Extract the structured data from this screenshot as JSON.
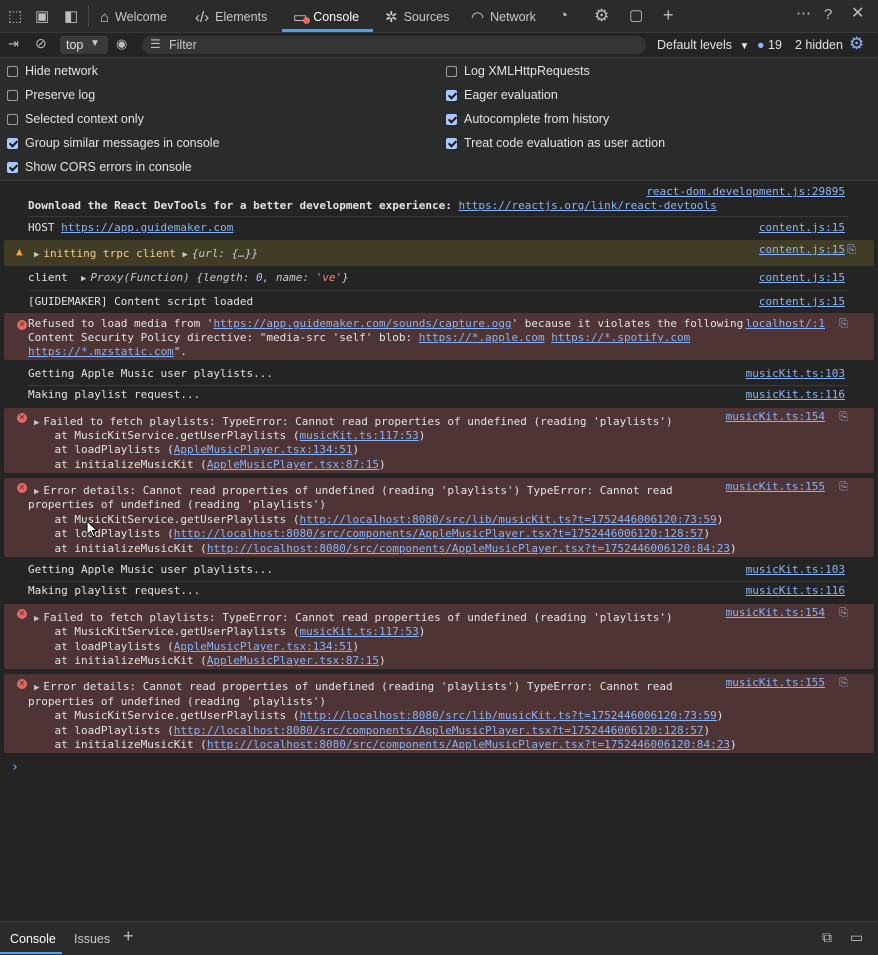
{
  "tabs": [
    {
      "label": "Welcome",
      "icon": "home-icon"
    },
    {
      "label": "Elements",
      "icon": "code-icon"
    },
    {
      "label": "Console",
      "icon": "console-icon"
    },
    {
      "label": "Sources",
      "icon": "bug-icon"
    },
    {
      "label": "Network",
      "icon": "wifi-icon"
    }
  ],
  "toolbar": {
    "context": "top",
    "filter_placeholder": "Filter",
    "levels": "Default levels",
    "issues_count": "19",
    "hidden": "2 hidden"
  },
  "settings": {
    "left": [
      {
        "label": "Hide network",
        "checked": false
      },
      {
        "label": "Preserve log",
        "checked": false
      },
      {
        "label": "Selected context only",
        "checked": false
      },
      {
        "label": "Group similar messages in console",
        "checked": true
      },
      {
        "label": "Show CORS errors in console",
        "checked": true
      }
    ],
    "right": [
      {
        "label": "Log XMLHttpRequests",
        "checked": false
      },
      {
        "label": "Eager evaluation",
        "checked": true
      },
      {
        "label": "Autocomplete from history",
        "checked": true
      },
      {
        "label": "Treat code evaluation as user action",
        "checked": true
      }
    ]
  },
  "console": {
    "m1_src": "react-dom.development.js:29895",
    "m1_text": "Download the React DevTools for a better development experience: ",
    "m1_link": "https://reactjs.org/link/react-devtools",
    "m2_text": "HOST ",
    "m2_link": "https://app.guidemaker.com",
    "m2_src": "content.js:15",
    "m3_text": "initting trpc client",
    "m3_obj": "{url: {…}}",
    "m3_src": "content.js:15",
    "m4_text": "client",
    "m4_obj_a": "Proxy(Function) {length: ",
    "m4_obj_num": "0",
    "m4_obj_b": ", name: ",
    "m4_obj_str": "'ve'",
    "m4_obj_c": "}",
    "m4_src": "content.js:15",
    "m5_text": "[GUIDEMAKER] Content script loaded",
    "m5_src": "content.js:15",
    "m6_a": "Refused to load media from '",
    "m6_link1": "https://app.guidemaker.com/sounds/capture.ogg",
    "m6_b": "' because it violates the following",
    "m6_c": "Content Security Policy directive: \"media-src 'self' blob: ",
    "m6_link2": "https://*.apple.com",
    "m6_link3": "https://*.spotify.com",
    "m6_link4": "https://*.mzstatic.com",
    "m6_d": "\".",
    "m6_src": "localhost/:1",
    "m7_text": "Getting Apple Music user playlists...",
    "m7_src": "musicKit.ts:103",
    "m8_text": "Making playlist request...",
    "m8_src": "musicKit.ts:116",
    "m9_text": "Failed to fetch playlists: TypeError: Cannot read properties of undefined (reading 'playlists')",
    "m9_src": "musicKit.ts:154",
    "m9_s1a": "    at MusicKitService.getUserPlaylists (",
    "m9_s1l": "musicKit.ts:117:53",
    "m9_s2a": "    at loadPlaylists (",
    "m9_s2l": "AppleMusicPlayer.tsx:134:51",
    "m9_s3a": "    at initializeMusicKit (",
    "m9_s3l": "AppleMusicPlayer.tsx:87:15",
    "close": ")",
    "m10_text1": "Error details: Cannot read properties of undefined (reading 'playlists') TypeError: Cannot read",
    "m10_text2": "properties of undefined (reading 'playlists')",
    "m10_src": "musicKit.ts:155",
    "m10_s1a": "    at MusicKitService.getUserPlaylists (",
    "m10_s1l": "http://localhost:8080/src/lib/musicKit.ts?t=1752446006120:73:59",
    "m10_s2a": "    at loadPlaylists (",
    "m10_s2l": "http://localhost:8080/src/components/AppleMusicPlayer.tsx?t=1752446006120:128:57",
    "m10_s3a": "    at initializeMusicKit (",
    "m10_s3l": "http://localhost:8080/src/components/AppleMusicPlayer.tsx?t=1752446006120:84:23"
  },
  "bottom": {
    "tab1": "Console",
    "tab2": "Issues"
  }
}
